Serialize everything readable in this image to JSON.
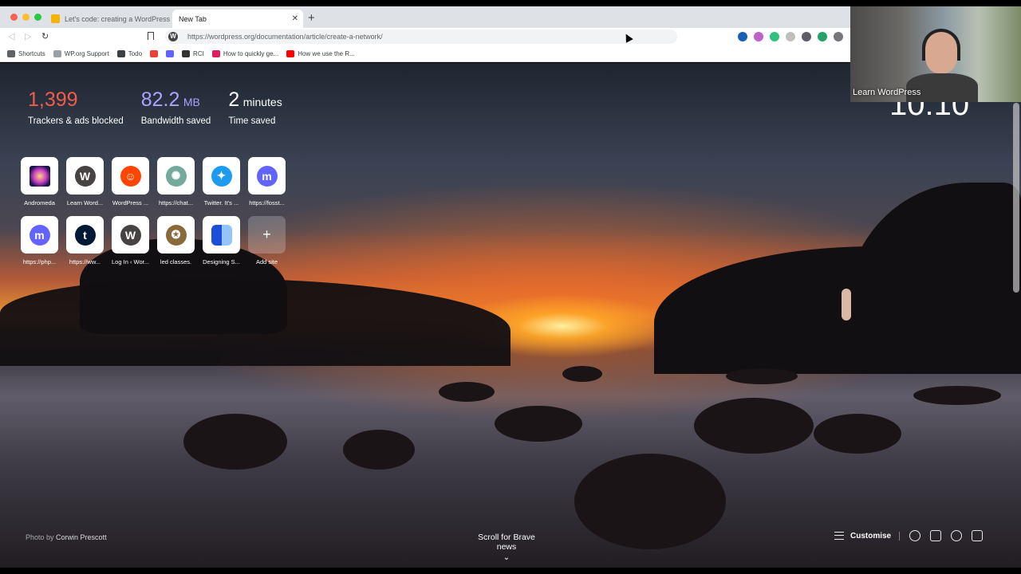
{
  "tabs": [
    {
      "title": "Let's code: creating a WordPress n",
      "active": false
    },
    {
      "title": "New Tab",
      "active": true
    }
  ],
  "toolbar": {
    "url": "https://wordpress.org/documentation/article/create-a-network/"
  },
  "bookmarks": [
    {
      "label": "Shortcuts",
      "icon": "grid-icon",
      "color": "#5f6368"
    },
    {
      "label": "WP.org Support",
      "icon": "folder-icon",
      "color": "#9aa0a6"
    },
    {
      "label": "Todo",
      "icon": "todo-icon",
      "color": "#3c4043"
    },
    {
      "label": "",
      "icon": "gmail-icon",
      "color": "#ea4335"
    },
    {
      "label": "",
      "icon": "mastodon-icon",
      "color": "#6364ff"
    },
    {
      "label": "RCI",
      "icon": "rci-icon",
      "color": "#333"
    },
    {
      "label": "How to quickly ge...",
      "icon": "slack-icon",
      "color": "#e01e5a"
    },
    {
      "label": "How we use the R...",
      "icon": "youtube-icon",
      "color": "#ff0000"
    }
  ],
  "stats": {
    "trackers_value": "1,399",
    "trackers_label": "Trackers & ads blocked",
    "bandwidth_value": "82.2",
    "bandwidth_unit": "MB",
    "bandwidth_label": "Bandwidth saved",
    "time_value": "2",
    "time_unit": "minutes",
    "time_label": "Time saved"
  },
  "top_sites": [
    {
      "label": "Andromeda",
      "icon": "andromeda-icon"
    },
    {
      "label": "Learn Word...",
      "icon": "wordpress-icon"
    },
    {
      "label": "WordPress ...",
      "icon": "reddit-icon"
    },
    {
      "label": "https://chat...",
      "icon": "chatgpt-icon"
    },
    {
      "label": "Twitter. It's ...",
      "icon": "twitter-icon"
    },
    {
      "label": "https://fosst...",
      "icon": "mastodon-icon"
    },
    {
      "label": "https://php...",
      "icon": "mastodon-icon"
    },
    {
      "label": "https://ww...",
      "icon": "tumblr-icon"
    },
    {
      "label": "Log In ‹ Wor...",
      "icon": "wordpress-icon"
    },
    {
      "label": "led classes.",
      "icon": "classes-icon"
    },
    {
      "label": "Designing S...",
      "icon": "designing-icon"
    },
    {
      "label": "Add site",
      "icon": "plus-icon"
    }
  ],
  "clock": "10:10",
  "photo_credit_prefix": "Photo by",
  "photo_credit_name": "Corwin Prescott",
  "brave_news": "Scroll for Brave news",
  "customise": "Customise",
  "webcam_label": "Learn WordPress",
  "colors": {
    "trackers": "#f25c4a",
    "bandwidth": "#a7a4ff",
    "tab_active": "#ffffff"
  }
}
